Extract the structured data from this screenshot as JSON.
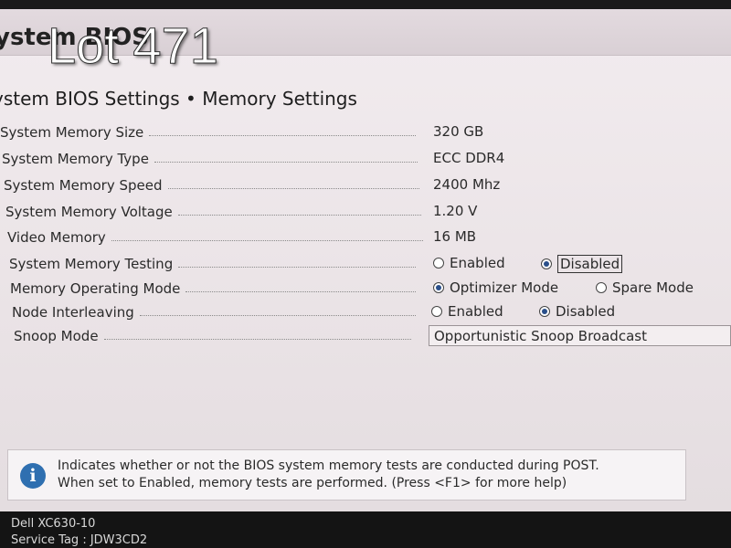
{
  "header": {
    "app_title": "ystem BIOS",
    "overlay_label": "Lot 471"
  },
  "page_title": "ystem BIOS Settings • Memory Settings",
  "settings": [
    {
      "label": "System Memory Size",
      "value": "320 GB"
    },
    {
      "label": "System Memory Type",
      "value": "ECC DDR4"
    },
    {
      "label": "System Memory Speed",
      "value": "2400 Mhz"
    },
    {
      "label": "System Memory Voltage",
      "value": "1.20 V"
    },
    {
      "label": "Video Memory",
      "value": "16 MB"
    },
    {
      "label": "System Memory Testing",
      "options": [
        "Enabled",
        "Disabled"
      ],
      "selected": "Disabled"
    },
    {
      "label": "Memory Operating Mode",
      "options": [
        "Optimizer Mode",
        "Spare Mode"
      ],
      "selected": "Optimizer Mode"
    },
    {
      "label": "Node Interleaving",
      "options": [
        "Enabled",
        "Disabled"
      ],
      "selected": "Disabled"
    },
    {
      "label": "Snoop Mode",
      "value": "Opportunistic Snoop Broadcast"
    }
  ],
  "help": {
    "icon": "info-icon",
    "line1": "Indicates whether or not the BIOS system memory tests are conducted during POST.",
    "line2": "When set to Enabled, memory tests are performed. (Press <F1> for more help)"
  },
  "footer": {
    "model": "Dell XC630-10",
    "service_tag": "Service Tag : JDW3CD2"
  },
  "colors": {
    "screen_bg": "#eee8eb",
    "info_icon": "#2f6fb0",
    "radio_fill": "#2a4f8a"
  }
}
